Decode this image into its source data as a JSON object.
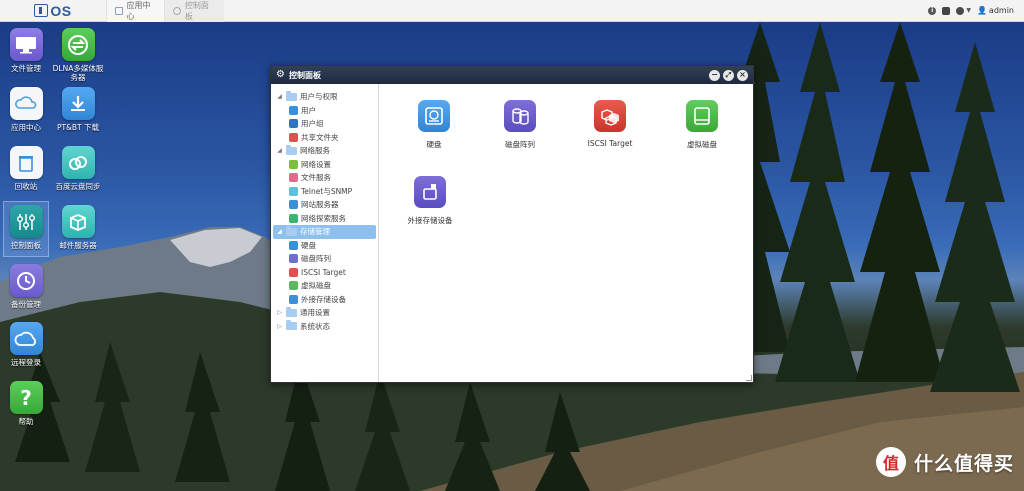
{
  "topbar": {
    "logo_text": "OS",
    "tabs": [
      {
        "label": "应用中心",
        "icon": "app-center-icon"
      },
      {
        "label": "控制面板",
        "icon": "control-panel-icon"
      }
    ],
    "user": "admin"
  },
  "desktop_icons": [
    {
      "name": "file-manager",
      "label": "文件管理",
      "icon": "monitor-icon"
    },
    {
      "name": "dlna",
      "label": "DLNA多媒体服务器",
      "icon": "share-icon"
    },
    {
      "name": "app-center",
      "label": "应用中心",
      "icon": "cloud-bag-icon"
    },
    {
      "name": "pt-bt",
      "label": "PT&BT 下载",
      "icon": "download-icon"
    },
    {
      "name": "recycle-bin",
      "label": "回收站",
      "icon": "trash-icon"
    },
    {
      "name": "baidu-sync",
      "label": "百度云盘同步",
      "icon": "baidu-cloud-icon"
    },
    {
      "name": "control-panel",
      "label": "控制面板",
      "icon": "sliders-icon"
    },
    {
      "name": "mail-server",
      "label": "邮件服务器",
      "icon": "mail-box-icon"
    },
    {
      "name": "backup",
      "label": "备份管理",
      "icon": "clock-icon"
    },
    {
      "name": "remote-login",
      "label": "远程登录",
      "icon": "cloud-icon"
    },
    {
      "name": "help",
      "label": "帮助",
      "icon": "question-icon"
    }
  ],
  "window": {
    "title": "控制面板",
    "tree": [
      {
        "level": 0,
        "label": "用户与权限",
        "expanded": true
      },
      {
        "level": 1,
        "label": "用户",
        "icon": "user-icon",
        "color": "#3a8fd9"
      },
      {
        "level": 1,
        "label": "用户组",
        "icon": "user-group-icon",
        "color": "#2f74c0"
      },
      {
        "level": 1,
        "label": "共享文件夹",
        "icon": "shared-folder-icon",
        "color": "#d9534f"
      },
      {
        "level": 0,
        "label": "网络服务",
        "expanded": true
      },
      {
        "level": 1,
        "label": "网络设置",
        "icon": "globe-icon",
        "color": "#7cbf3c"
      },
      {
        "level": 1,
        "label": "文件服务",
        "icon": "file-service-icon",
        "color": "#e06b8b"
      },
      {
        "level": 1,
        "label": "Telnet与SNMP",
        "icon": "telnet-icon",
        "color": "#5bc0de"
      },
      {
        "level": 1,
        "label": "网站服务器",
        "icon": "web-server-icon",
        "color": "#3a8fd9"
      },
      {
        "level": 1,
        "label": "网络探索服务",
        "icon": "network-discovery-icon",
        "color": "#3cb371"
      },
      {
        "level": 0,
        "label": "存储管理",
        "expanded": true,
        "active": true
      },
      {
        "level": 1,
        "label": "硬盘",
        "icon": "disk-icon",
        "color": "#3a8fd9"
      },
      {
        "level": 1,
        "label": "磁盘阵列",
        "icon": "raid-icon",
        "color": "#6f6fc9"
      },
      {
        "level": 1,
        "label": "ISCSI Target",
        "icon": "iscsi-icon",
        "color": "#d9534f"
      },
      {
        "level": 1,
        "label": "虚拟磁盘",
        "icon": "virtual-disk-icon",
        "color": "#5cb85c"
      },
      {
        "level": 1,
        "label": "外接存储设备",
        "icon": "external-storage-icon",
        "color": "#3a8fd9"
      },
      {
        "level": 0,
        "label": "通用设置",
        "expanded": false
      },
      {
        "level": 0,
        "label": "系统状态",
        "expanded": false
      }
    ],
    "apps": [
      {
        "label": "硬盘",
        "icon": "hard-disk-icon",
        "color": "#3b8fe0"
      },
      {
        "label": "磁盘阵列",
        "icon": "disk-array-icon",
        "color": "#6a5fc7"
      },
      {
        "label": "ISCSI Target",
        "icon": "iscsi-target-icon",
        "color": "#e0463c"
      },
      {
        "label": "虚拟磁盘",
        "icon": "virtual-disk-icon",
        "color": "#4cbc4a"
      },
      {
        "label": "外接存储设备",
        "icon": "external-storage-icon",
        "color": "#6a5fc7"
      }
    ]
  },
  "watermark": {
    "symbol": "值",
    "text": "什么值得买"
  }
}
